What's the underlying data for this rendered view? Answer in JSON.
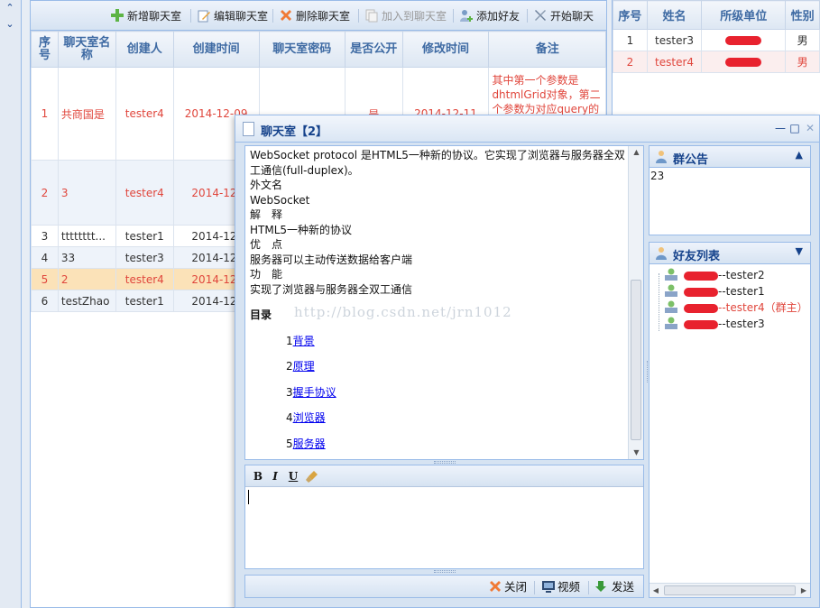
{
  "toolbar": {
    "add_room": "新增聊天室",
    "edit_room": "编辑聊天室",
    "delete_room": "删除聊天室",
    "join_room": "加入到聊天室",
    "add_friend": "添加好友",
    "start_chat": "开始聊天"
  },
  "grid": {
    "headers": [
      "序号",
      "聊天室名称",
      "创建人",
      "创建时间",
      "聊天室密码",
      "是否公开",
      "修改时间",
      "备注"
    ],
    "rows": [
      {
        "no": "1",
        "name": "共商国是",
        "creator": "tester4",
        "created": "2014-12-09",
        "password": "",
        "public": "是",
        "modified": "2014-12-11",
        "note": "其中第一个参数是dhtmlGrid对象，第二个参数为对应query的"
      },
      {
        "no": "2",
        "name": "3",
        "creator": "tester4",
        "created": "2014-12-"
      },
      {
        "no": "3",
        "name": "tttttttt...",
        "creator": "tester1",
        "created": "2014-12-"
      },
      {
        "no": "4",
        "name": "33",
        "creator": "tester3",
        "created": "2014-12-"
      },
      {
        "no": "5",
        "name": "2",
        "creator": "tester4",
        "created": "2014-12-"
      },
      {
        "no": "6",
        "name": "testZhao",
        "creator": "tester1",
        "created": "2014-12-"
      }
    ]
  },
  "right_grid": {
    "headers": [
      "序号",
      "姓名",
      "所级单位",
      "性别"
    ],
    "rows": [
      {
        "no": "1",
        "name": "tester3",
        "gender": "男"
      },
      {
        "no": "2",
        "name": "tester4",
        "gender": "男"
      }
    ]
  },
  "chat": {
    "title": "聊天室【2】",
    "message_lines": [
      "WebSocket protocol 是HTML5一种新的协议。它实现了浏览器与服务器全双工通信(full-duplex)。",
      "外文名",
      "WebSocket",
      "解　释",
      "HTML5一种新的协议",
      "优　点",
      "服务器可以主动传送数据给客户端",
      "功　能",
      "实现了浏览器与服务器全双工通信"
    ],
    "toc_title": "目录",
    "toc": [
      {
        "num": "1",
        "text": "背景"
      },
      {
        "num": "2",
        "text": "原理"
      },
      {
        "num": "3",
        "text": "握手协议"
      },
      {
        "num": "4",
        "text": "浏览器"
      },
      {
        "num": "5",
        "text": "服务器"
      }
    ],
    "watermark": "http://blog.csdn.net/jrn1012",
    "editor_buttons": {
      "bold": "B",
      "italic": "I",
      "underline": "U"
    },
    "close_label": "关闭",
    "video_label": "视频",
    "send_label": "发送",
    "announcement_title": "群公告",
    "announcement_text": "23",
    "friends_title": "好友列表",
    "friends": [
      {
        "label": "--tester2",
        "owner": false
      },
      {
        "label": "--tester1",
        "owner": false
      },
      {
        "label": "--tester4（群主）",
        "owner": true
      },
      {
        "label": "--tester3",
        "owner": false
      }
    ]
  },
  "colors": {
    "accent": "#15428b",
    "border": "#99bbe8",
    "highlight_text": "#e0463c",
    "selected_row": "#fbe2b8"
  }
}
